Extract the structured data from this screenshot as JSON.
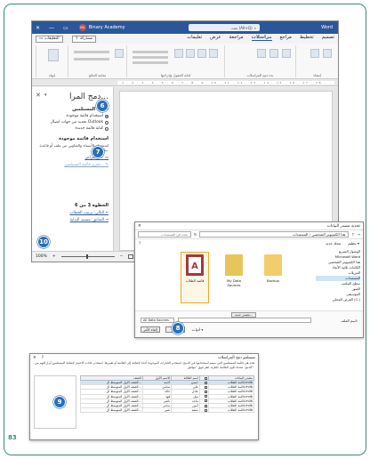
{
  "page_number": "83",
  "badges": {
    "b6": "6",
    "b7": "7",
    "b8": "8",
    "b9": "9",
    "b10": "10"
  },
  "word": {
    "app_name": "Word",
    "account_name": "Binary Academy",
    "account_initials": "BA",
    "search_text": "بحث (Alt+Q)",
    "share_label": "مشاركة",
    "comments_label": "التعليقات",
    "tabs": [
      "تعليمات",
      "عرض",
      "مراجعة",
      "مراسلات",
      "مراجع",
      "تخطيط",
      "تصميم"
    ],
    "active_tab": "مراسلات",
    "ribbon_groups": [
      "إنشاء",
      "بدء دمج المراسلات",
      "كتابة الحقول وإدراجها",
      "معاينة النتائج",
      "إنهاء"
    ],
    "ribbon_buttons": [
      "المغلفات",
      "التسميات",
      "بدء دمج المراسلات",
      "تحديد المستلمين",
      "تحرير قائمة المستلمين",
      "تمييز حقول الدمج",
      "كتلة عنوان",
      "سطر الترحيب",
      "إدراج حقل دمج",
      "قواعد",
      "مطابقة الحقول",
      "تحديث التسميات",
      "معاينة النتائج",
      "البحث عن مستلم",
      "التحقق من وجود أخطاء",
      "إنهاء ودمج"
    ],
    "pane": {
      "title": "دمج المرا...",
      "section1_title": "تحديد المستلمين",
      "option_existing": "استخدام قائمة موجودة",
      "option_outlook": "تحديد من جهات اتصال Outlook",
      "option_new": "كتابة قائمة جديدة",
      "section2_title": "استخدام قائمة موجودة",
      "section2_desc": "استخدام الأسماء والعناوين من ملف أو قاعدة بيانات.",
      "browse_link": "استعراض...",
      "edit_link": "تحرير قائمة المستلمين...",
      "step_text": "الخطوة 3 من 6",
      "next_link": "التالي: ترتيب الخطاب",
      "prev_link": "السابق: مستند البداية"
    },
    "status": {
      "zoom": "100%"
    }
  },
  "file_dialog": {
    "title": "تحديد مصدر البيانات",
    "address_path": "هذا الكمبيوتر الشخصي › المستندات",
    "search_placeholder": "بحث في المستندات",
    "organize_label": "تنظيم ▾",
    "new_folder_label": "مجلد جديد",
    "nav_items": [
      "الوصول السريع",
      "Microsoft Word",
      "هذا الكمبيوتر الشخصي",
      "الكائنات ثلاثية الأبعاد",
      "التنزيلات",
      "المستندات",
      "سطح المكتب",
      "الصور",
      "الموسيقى",
      "القرص المحلي (C:)"
    ],
    "nav_selected_index": 5,
    "files": [
      {
        "name": "قائمة الطلاب",
        "icon": "access-db-icon",
        "selected": true
      },
      {
        "name": "My Data Sources",
        "icon": "folder-data-icon",
        "selected": false
      },
      {
        "name": "Backup",
        "icon": "folder-icon",
        "selected": false
      }
    ],
    "filename_label": "اسم الملف:",
    "filetype_value": "All Data Sources",
    "tools_label": "أدوات ▾",
    "open_button": "فتح",
    "cancel_button": "إلغاء الأمر",
    "new_source_button": "مصدر جديد..."
  },
  "recipients_dialog": {
    "title": "مستلمو دمج المراسلات",
    "description": "هذه هي قائمة المستلمين التي سيتم استخدامها في الدمج. استخدم الخيارات الموجودة أدناه لإضافة إلى القائمة أو تغييرها. استخدم خانات الاختيار لإضافة المستلمين أو إزالتهم من الدمج. عندما تكون القائمة جاهزة، انقر فوق \"موافق\".",
    "columns": [
      "مصدر البيانات",
      "",
      "اسم العائلة",
      "الاسم الأول",
      "الصف"
    ],
    "rows": [
      {
        "source": "قائمة الطلاب.mdb",
        "last": "حسن",
        "first": "أحمد",
        "grade": "الصف الأول المتوسط ال...",
        "hl": true
      },
      {
        "source": "قائمة الطلاب.mdb",
        "last": "علي",
        "first": "سامي",
        "grade": "الصف الأول المتوسط ال...",
        "hl": false
      },
      {
        "source": "قائمة الطلاب.mdb",
        "last": "عادل",
        "first": "خالد",
        "grade": "الصف الأول المتوسط ال...",
        "hl": false
      },
      {
        "source": "قائمة الطلاب.mdb",
        "last": "نبيل",
        "first": "فهد",
        "grade": "الصف الأول المتوسط ال...",
        "hl": false
      },
      {
        "source": "قائمة الطلاب.mdb",
        "last": "ماجد",
        "first": "ناصر",
        "grade": "الصف الأول المتوسط ال...",
        "hl": false
      },
      {
        "source": "قائمة الطلاب.mdb",
        "last": "أمين",
        "first": "سامر",
        "grade": "الصف الأول المتوسط ال...",
        "hl": false
      },
      {
        "source": "قائمة الطلاب.mdb",
        "last": "سعيد",
        "first": "عمر",
        "grade": "الصف الأول المتوسط ال...",
        "hl": false
      }
    ]
  },
  "colors": {
    "word_blue": "#2b579a",
    "badge_blue": "#2a6fb5",
    "frame_green": "#3a8a7a",
    "highlight": "#f5a623"
  }
}
